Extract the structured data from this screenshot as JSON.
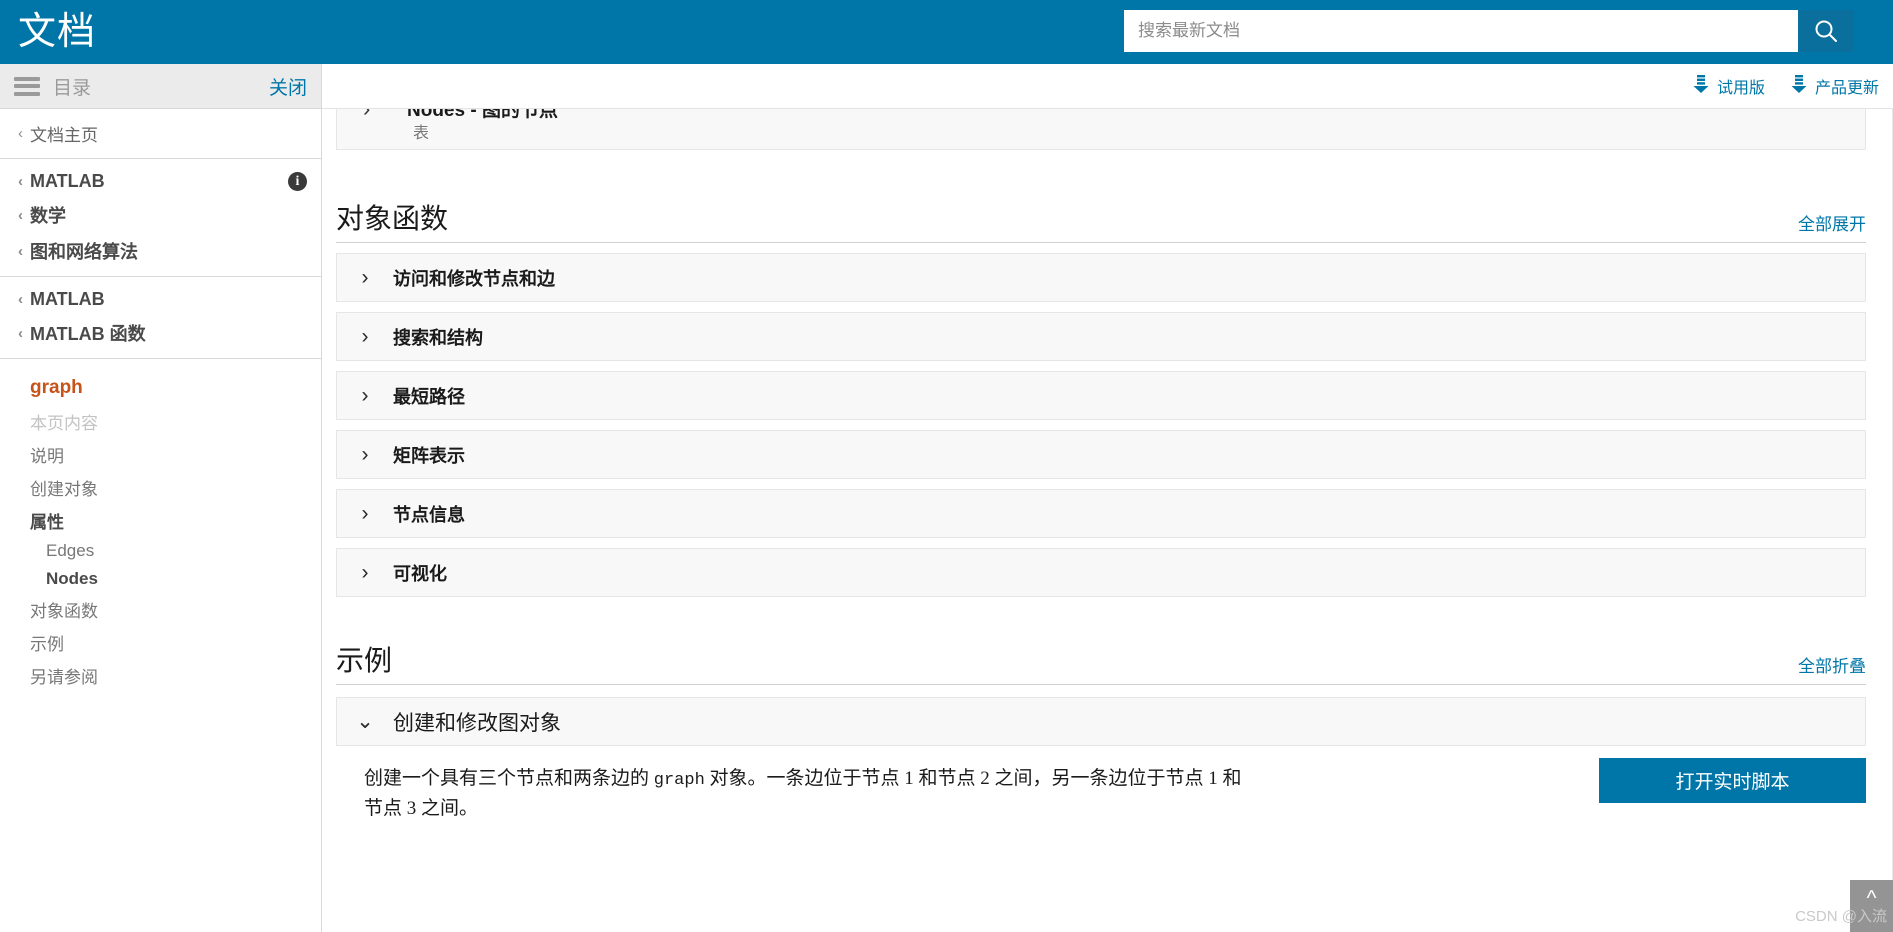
{
  "header": {
    "site_title": "文档",
    "brand_color": "#0076a8",
    "search": {
      "placeholder": "搜索最新文档",
      "value": "",
      "button_icon": "search-icon"
    }
  },
  "toolbar": {
    "links": [
      {
        "label": "试用版",
        "icon": "download-icon"
      },
      {
        "label": "产品更新",
        "icon": "download-icon"
      }
    ]
  },
  "sidebar": {
    "toc_header": {
      "menu_icon": "hamburger-icon",
      "label": "目录",
      "close_label": "关闭"
    },
    "breadcrumb_groups": [
      {
        "items": [
          {
            "label": "文档主页",
            "bold": false
          }
        ],
        "info_icon": false
      },
      {
        "items": [
          {
            "label": "MATLAB",
            "bold": true
          },
          {
            "label": "数学",
            "bold": true
          },
          {
            "label": "图和网络算法",
            "bold": true
          }
        ],
        "info_icon": true
      },
      {
        "items": [
          {
            "label": "MATLAB",
            "bold": true
          },
          {
            "label": "MATLAB 函数",
            "bold": true
          }
        ],
        "info_icon": false
      }
    ],
    "toc": [
      {
        "label": "graph",
        "style": "page-title"
      },
      {
        "label": "本页内容",
        "style": "section-label"
      },
      {
        "label": "说明",
        "style": "normal"
      },
      {
        "label": "创建对象",
        "style": "normal"
      },
      {
        "label": "属性",
        "style": "active"
      },
      {
        "label": "Edges",
        "style": "indent"
      },
      {
        "label": "Nodes",
        "style": "indent active"
      },
      {
        "label": "对象函数",
        "style": "normal"
      },
      {
        "label": "示例",
        "style": "normal"
      },
      {
        "label": "另请参阅",
        "style": "normal"
      }
    ]
  },
  "content": {
    "cut_card": {
      "title": "Nodes - 图的节点",
      "subtitle": "表",
      "chevron": "chevron-right-icon"
    },
    "object_functions": {
      "heading": "对象函数",
      "toggle_all": "全部展开",
      "rows": [
        {
          "label": "访问和修改节点和边",
          "expanded": false
        },
        {
          "label": "搜索和结构",
          "expanded": false
        },
        {
          "label": "最短路径",
          "expanded": false
        },
        {
          "label": "矩阵表示",
          "expanded": false
        },
        {
          "label": "节点信息",
          "expanded": false
        },
        {
          "label": "可视化",
          "expanded": false
        }
      ]
    },
    "examples": {
      "heading": "示例",
      "toggle_all": "全部折叠",
      "expanded_row": {
        "label": "创建和修改图对象",
        "expanded": true
      },
      "body_text_1": "创建一个具有三个节点和两条边的 ",
      "body_mono": "graph",
      "body_text_2": " 对象。一条边位于节点 1 和节点 2 之间，另一条边位于节点 1 和节点 3 之间。",
      "live_script_button": "打开实时脚本"
    }
  },
  "overlay": {
    "scroll_top_icon": "chevron-up-icon",
    "watermark": "CSDN @入流"
  }
}
